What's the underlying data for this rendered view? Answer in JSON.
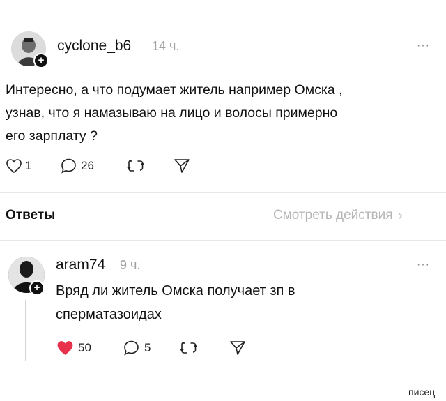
{
  "post": {
    "username": "cyclone_b6",
    "time": "14 ч.",
    "more": "···",
    "text_lines": [
      "Интересно, а что подумает житель например Омска ,",
      "узнав,  что я намазываю на лицо и волосы примерно",
      "его зарплату ?"
    ],
    "likes": "1",
    "comments": "26"
  },
  "replies_header": {
    "title": "Ответы",
    "link": "Смотреть действия"
  },
  "reply": {
    "username": "aram74",
    "time": "9 ч.",
    "more": "···",
    "text_lines": [
      "Вряд ли житель Омска получает зп в",
      "спермaтазоидах"
    ],
    "likes": "50",
    "comments": "5"
  },
  "watermark": "писец",
  "colors": {
    "like_filled": "#e8324c",
    "muted": "#a0a0a0",
    "text": "#111111"
  }
}
